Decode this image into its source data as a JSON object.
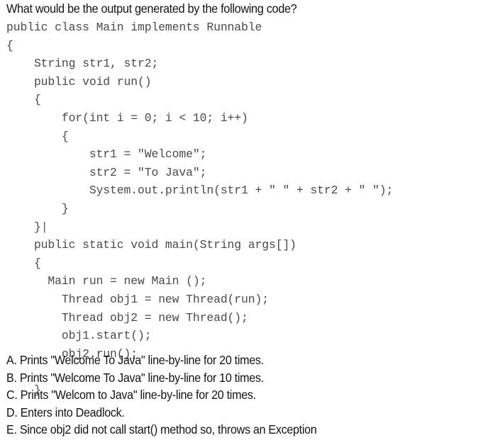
{
  "question": {
    "prompt": "What would be the output generated by the following code?"
  },
  "code": {
    "language": "java",
    "lines": [
      "public class Main implements Runnable",
      "{",
      "    String str1, str2;",
      "    public void run()",
      "    {",
      "        for(int i = 0; i < 10; i++)",
      "        {",
      "            str1 = \"Welcome\";",
      "            str2 = \"To Java\";",
      "            System.out.println(str1 + \" \" + str2 + \" \");",
      "        }",
      "    }",
      "    public static void main(String args[])",
      "    {",
      "      Main run = new Main ();",
      "        Thread obj1 = new Thread(run);",
      "        Thread obj2 = new Thread();",
      "        obj1.start();",
      "        obj2.run();",
      "",
      "    }",
      "}"
    ],
    "caret_line_index": 11,
    "caret_glyph": "|"
  },
  "options": [
    {
      "label": "A.",
      "text": "A. Prints \"Welcome To Java\" line-by-line for 20 times."
    },
    {
      "label": "B.",
      "text": "B. Prints \"Welcome To Java\" line-by-line for 10 times."
    },
    {
      "label": "C.",
      "text": "C. Prints \"Welcom to Java\" line-by-line for 20 times."
    },
    {
      "label": "D.",
      "text": "D. Enters into Deadlock."
    },
    {
      "label": "E.",
      "text": "E. Since obj2 did not call start() method so, throws an Exception"
    }
  ],
  "colors": {
    "background": "#ffffff",
    "question_text": "#141414",
    "code_text": "#4a4a4a",
    "option_text": "#141414"
  }
}
